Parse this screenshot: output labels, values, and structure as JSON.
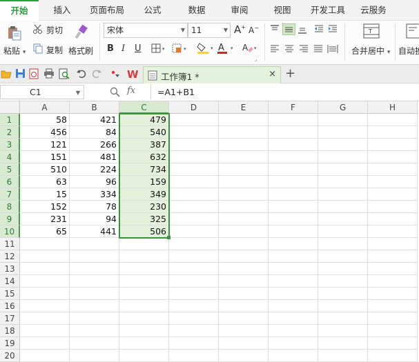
{
  "menu": {
    "tabs": [
      {
        "label": "开始",
        "active": true
      },
      {
        "label": "插入"
      },
      {
        "label": "页面布局"
      },
      {
        "label": "公式"
      },
      {
        "label": "数据"
      },
      {
        "label": "审阅"
      },
      {
        "label": "视图"
      },
      {
        "label": "开发工具"
      },
      {
        "label": "云服务"
      }
    ]
  },
  "ribbon": {
    "paste_label": "粘贴",
    "cut_label": "剪切",
    "copy_label": "复制",
    "format_painter_label": "格式刷",
    "font_name": "宋体",
    "font_size": "11",
    "bold": "B",
    "italic": "I",
    "underline": "U",
    "merge_center_label": "合并居中",
    "auto_wrap_label": "自动换"
  },
  "quickbar": {
    "doc_title": "工作簿1 *",
    "close_glyph": "×",
    "new_tab_glyph": "+"
  },
  "formula_bar": {
    "name_box": "C1",
    "fx": "fx",
    "formula": "=A1+B1"
  },
  "sheet": {
    "columns": [
      "A",
      "B",
      "C",
      "D",
      "E",
      "F",
      "G",
      "H"
    ],
    "selected_column": "C",
    "rows": [
      {
        "num": "1",
        "a": "58",
        "b": "421",
        "c": "479"
      },
      {
        "num": "2",
        "a": "456",
        "b": "84",
        "c": "540"
      },
      {
        "num": "3",
        "a": "121",
        "b": "266",
        "c": "387"
      },
      {
        "num": "4",
        "a": "151",
        "b": "481",
        "c": "632"
      },
      {
        "num": "5",
        "a": "510",
        "b": "224",
        "c": "734"
      },
      {
        "num": "6",
        "a": "63",
        "b": "96",
        "c": "159"
      },
      {
        "num": "7",
        "a": "15",
        "b": "334",
        "c": "349"
      },
      {
        "num": "8",
        "a": "152",
        "b": "78",
        "c": "230"
      },
      {
        "num": "9",
        "a": "231",
        "b": "94",
        "c": "325"
      },
      {
        "num": "10",
        "a": "65",
        "b": "441",
        "c": "506"
      },
      {
        "num": "11",
        "a": "",
        "b": "",
        "c": ""
      },
      {
        "num": "12",
        "a": "",
        "b": "",
        "c": ""
      },
      {
        "num": "13",
        "a": "",
        "b": "",
        "c": ""
      },
      {
        "num": "14",
        "a": "",
        "b": "",
        "c": ""
      },
      {
        "num": "15",
        "a": "",
        "b": "",
        "c": ""
      },
      {
        "num": "16",
        "a": "",
        "b": "",
        "c": ""
      },
      {
        "num": "17",
        "a": "",
        "b": "",
        "c": ""
      },
      {
        "num": "18",
        "a": "",
        "b": "",
        "c": ""
      },
      {
        "num": "19",
        "a": "",
        "b": "",
        "c": ""
      },
      {
        "num": "20",
        "a": "",
        "b": "",
        "c": ""
      }
    ]
  },
  "colors": {
    "accent": "#2e9b3e",
    "selection_fill": "#e4f0dc",
    "selection_border": "#3f8f3f"
  }
}
